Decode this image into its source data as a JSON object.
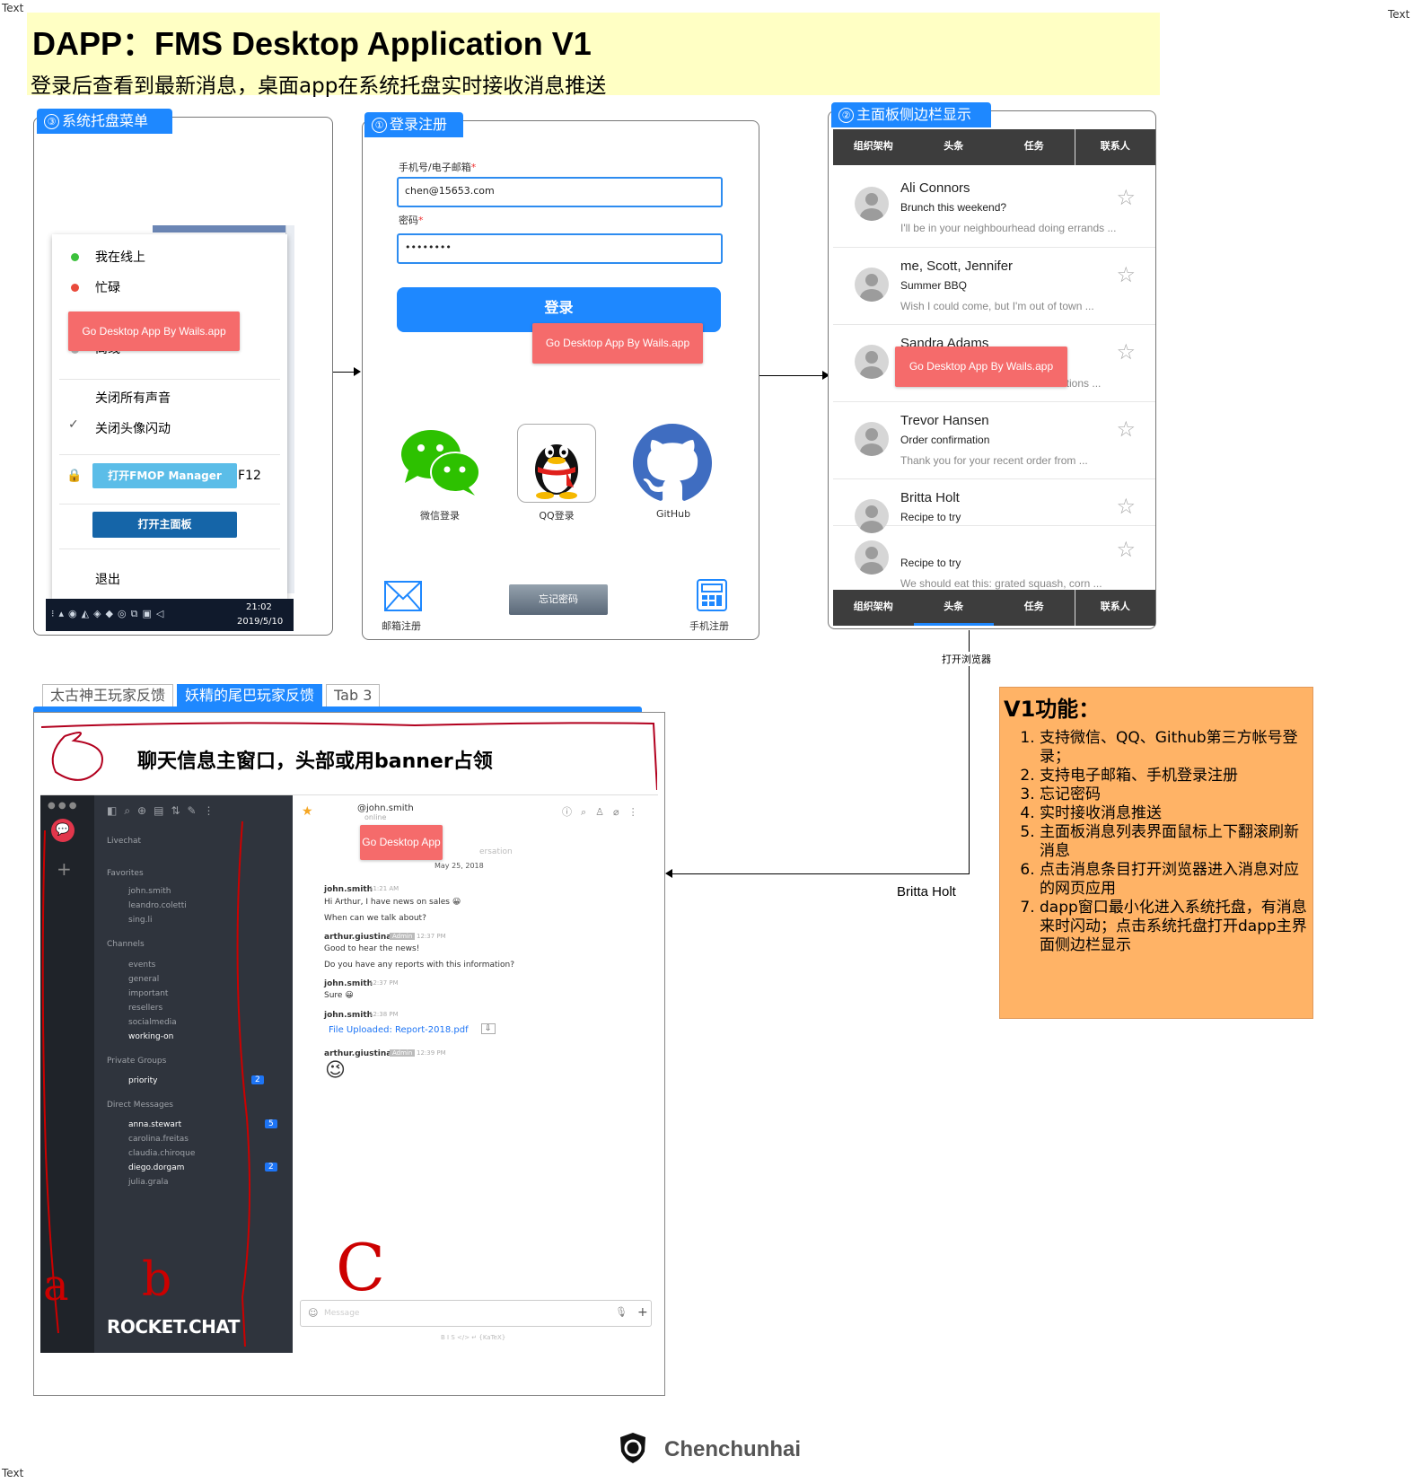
{
  "corner_labels": {
    "top_left": "Text",
    "top_right": "Text",
    "bottom_left": "Text"
  },
  "title": {
    "main": "DAPP：FMS Desktop Application V1",
    "subtitle": "登录后查看到最新消息，桌面app在系统托盘实时接收消息推送"
  },
  "tray_panel": {
    "tag_num": "③",
    "tag_label": "系统托盘菜单",
    "menu": {
      "online": "我在线上",
      "busy": "忙碌",
      "offline": "离线",
      "mute_all": "关闭所有声音",
      "no_flash": "关闭头像闪动",
      "open_manager": "打开FMOP Manager",
      "f12": "F12",
      "open_main": "打开主面板",
      "exit": "退出"
    },
    "banner": "Go Desktop App By Wails.app",
    "taskbar": {
      "time": "21:02",
      "date": "2019/5/10"
    },
    "colors": {
      "online": "#3cc13c",
      "busy": "#e94b3c",
      "offline": "#bbbbbb"
    }
  },
  "login_panel": {
    "tag_num": "①",
    "tag_label": "登录注册",
    "account_label": "手机号/电子邮箱",
    "account_value": "chen@15653.com",
    "password_label": "密码",
    "password_value": "••••••••",
    "login_button": "登录",
    "banner": "Go Desktop App By Wails.app",
    "social": [
      {
        "icon": "wechat-icon",
        "label": "微信登录"
      },
      {
        "icon": "qq-icon",
        "label": "QQ登录"
      },
      {
        "icon": "github-icon",
        "label": "GitHub"
      }
    ],
    "email_register": "邮箱注册",
    "forgot_password": "忘记密码",
    "phone_register": "手机注册"
  },
  "main_panel": {
    "tag_num": "②",
    "tag_label": "主面板侧边栏显示",
    "nav": [
      "组织架构",
      "头条",
      "任务",
      "联系人"
    ],
    "active_nav": "头条",
    "banner": "Go Desktop App By Wails.app",
    "messages": [
      {
        "name": "Ali Connors",
        "subject": "Brunch this weekend?",
        "preview": "I'll be in your neighbourhead doing errands ..."
      },
      {
        "name": "me, Scott, Jennifer",
        "subject": "Summer BBQ",
        "preview": "Wish I could come, but I'm out of town ..."
      },
      {
        "name": "Sandra Adams",
        "subject": "",
        "preview": "ations ..."
      },
      {
        "name": "Trevor Hansen",
        "subject": "Order confirmation",
        "preview": "Thank you for your recent order from ..."
      },
      {
        "name": "Britta Holt",
        "subject": "Recipe to try",
        "preview": ""
      },
      {
        "name": "",
        "subject": "Recipe to try",
        "preview": "We should eat this: grated squash, corn ..."
      }
    ]
  },
  "connector_labels": {
    "open_browser": "打开浏览器",
    "britta": "Britta Holt"
  },
  "chat_panel": {
    "tabs": [
      "太古神王玩家反馈",
      "妖精的尾巴玩家反馈",
      "Tab 3"
    ],
    "active_tab": "妖精的尾巴玩家反馈",
    "banner_text": "聊天信息主窗口，头部或用banner占领",
    "overlay_banner": "Go Desktop App",
    "rocket": {
      "user": "@john.smith",
      "status": "online",
      "sections": {
        "livechat": "Livechat",
        "favorites": "Favorites",
        "channels": "Channels",
        "private_groups": "Private Groups",
        "direct_messages": "Direct Messages"
      },
      "favorites": [
        "john.smith",
        "leandro.coletti",
        "sing.li"
      ],
      "channels": [
        "events",
        "general",
        "important",
        "resellers",
        "socialmedia",
        "working-on"
      ],
      "private_groups": [
        "priority"
      ],
      "private_badge": "2",
      "direct_messages": [
        "anna.stewart",
        "carolina.freitas",
        "claudia.chiroque",
        "diego.dorgam",
        "julia.grala"
      ],
      "dm_badges": {
        "anna.stewart": "5",
        "diego.dorgam": "2"
      },
      "date_divider": "May 25, 2018",
      "conversation_fragment": "ersation",
      "messages": [
        {
          "user": "john.smith",
          "time": "11:21 AM",
          "lines": [
            "Hi Arthur, I have news on sales 😀",
            "When can we talk about?"
          ]
        },
        {
          "user": "arthur.giustina",
          "role": "Admin",
          "time": "12:37 PM",
          "lines": [
            "Good to hear the news!",
            "Do you have any reports with this information?"
          ]
        },
        {
          "user": "john.smith",
          "time": "12:37 PM",
          "lines": [
            "Sure 😀"
          ]
        },
        {
          "user": "john.smith",
          "time": "12:38 PM",
          "lines": [
            "File Uploaded: Report-2018.pdf"
          ]
        },
        {
          "user": "arthur.giustina",
          "role": "Admin",
          "time": "12:39 PM",
          "lines": [
            "😉"
          ]
        }
      ],
      "composer_placeholder": "Message",
      "format_hint": "B  I  S  </>  ↵  {KaTeX}",
      "brand": "ROCKET.CHAT"
    },
    "annotations": {
      "a": "a",
      "b": "b",
      "c": "C"
    }
  },
  "features": {
    "title": "V1功能：",
    "items": [
      "支持微信、QQ、Github第三方帐号登录；",
      "支持电子邮箱、手机登录注册",
      "忘记密码",
      "实时接收消息推送",
      "主面板消息列表界面鼠标上下翻滚刷新消息",
      "点击消息条目打开浏览器进入消息对应的网页应用",
      "dapp窗口最小化进入系统托盘，有消息来时闪动；点击系统托盘打开dapp主界面侧边栏显示"
    ]
  },
  "footer": {
    "author": "Chenchunhai"
  }
}
